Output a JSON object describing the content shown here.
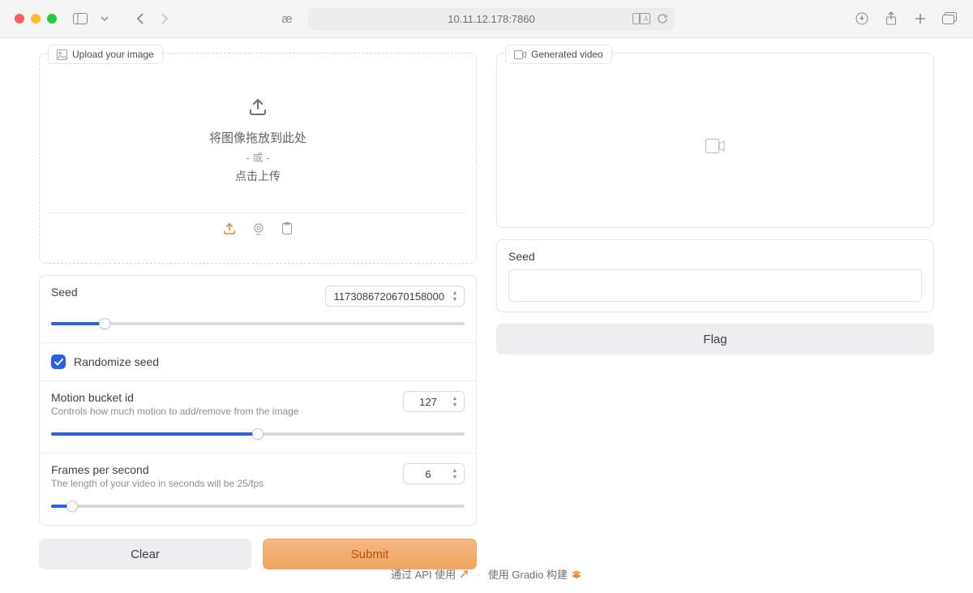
{
  "browser": {
    "address": "10.11.12.178:7860",
    "reader_icon_text": "æ"
  },
  "left": {
    "upload": {
      "label": "Upload your image",
      "line1": "将图像拖放到此处",
      "line_or": "- 或 -",
      "line2": "点击上传"
    },
    "seed": {
      "title": "Seed",
      "value": "1173086720670158000",
      "fill_pct": 13
    },
    "randomize": {
      "label": "Randomize seed",
      "checked": true
    },
    "motion": {
      "title": "Motion bucket id",
      "desc": "Controls how much motion to add/remove from the image",
      "value": "127",
      "fill_pct": 50
    },
    "fps": {
      "title": "Frames per second",
      "desc": "The length of your video in seconds will be 25/fps",
      "value": "6",
      "fill_pct": 5
    },
    "buttons": {
      "clear": "Clear",
      "submit": "Submit"
    }
  },
  "right": {
    "video_label": "Generated video",
    "seed_label": "Seed",
    "flag": "Flag"
  },
  "footer": {
    "api_text": "通过 API 使用",
    "gradio_text": "使用 Gradio 构建"
  }
}
